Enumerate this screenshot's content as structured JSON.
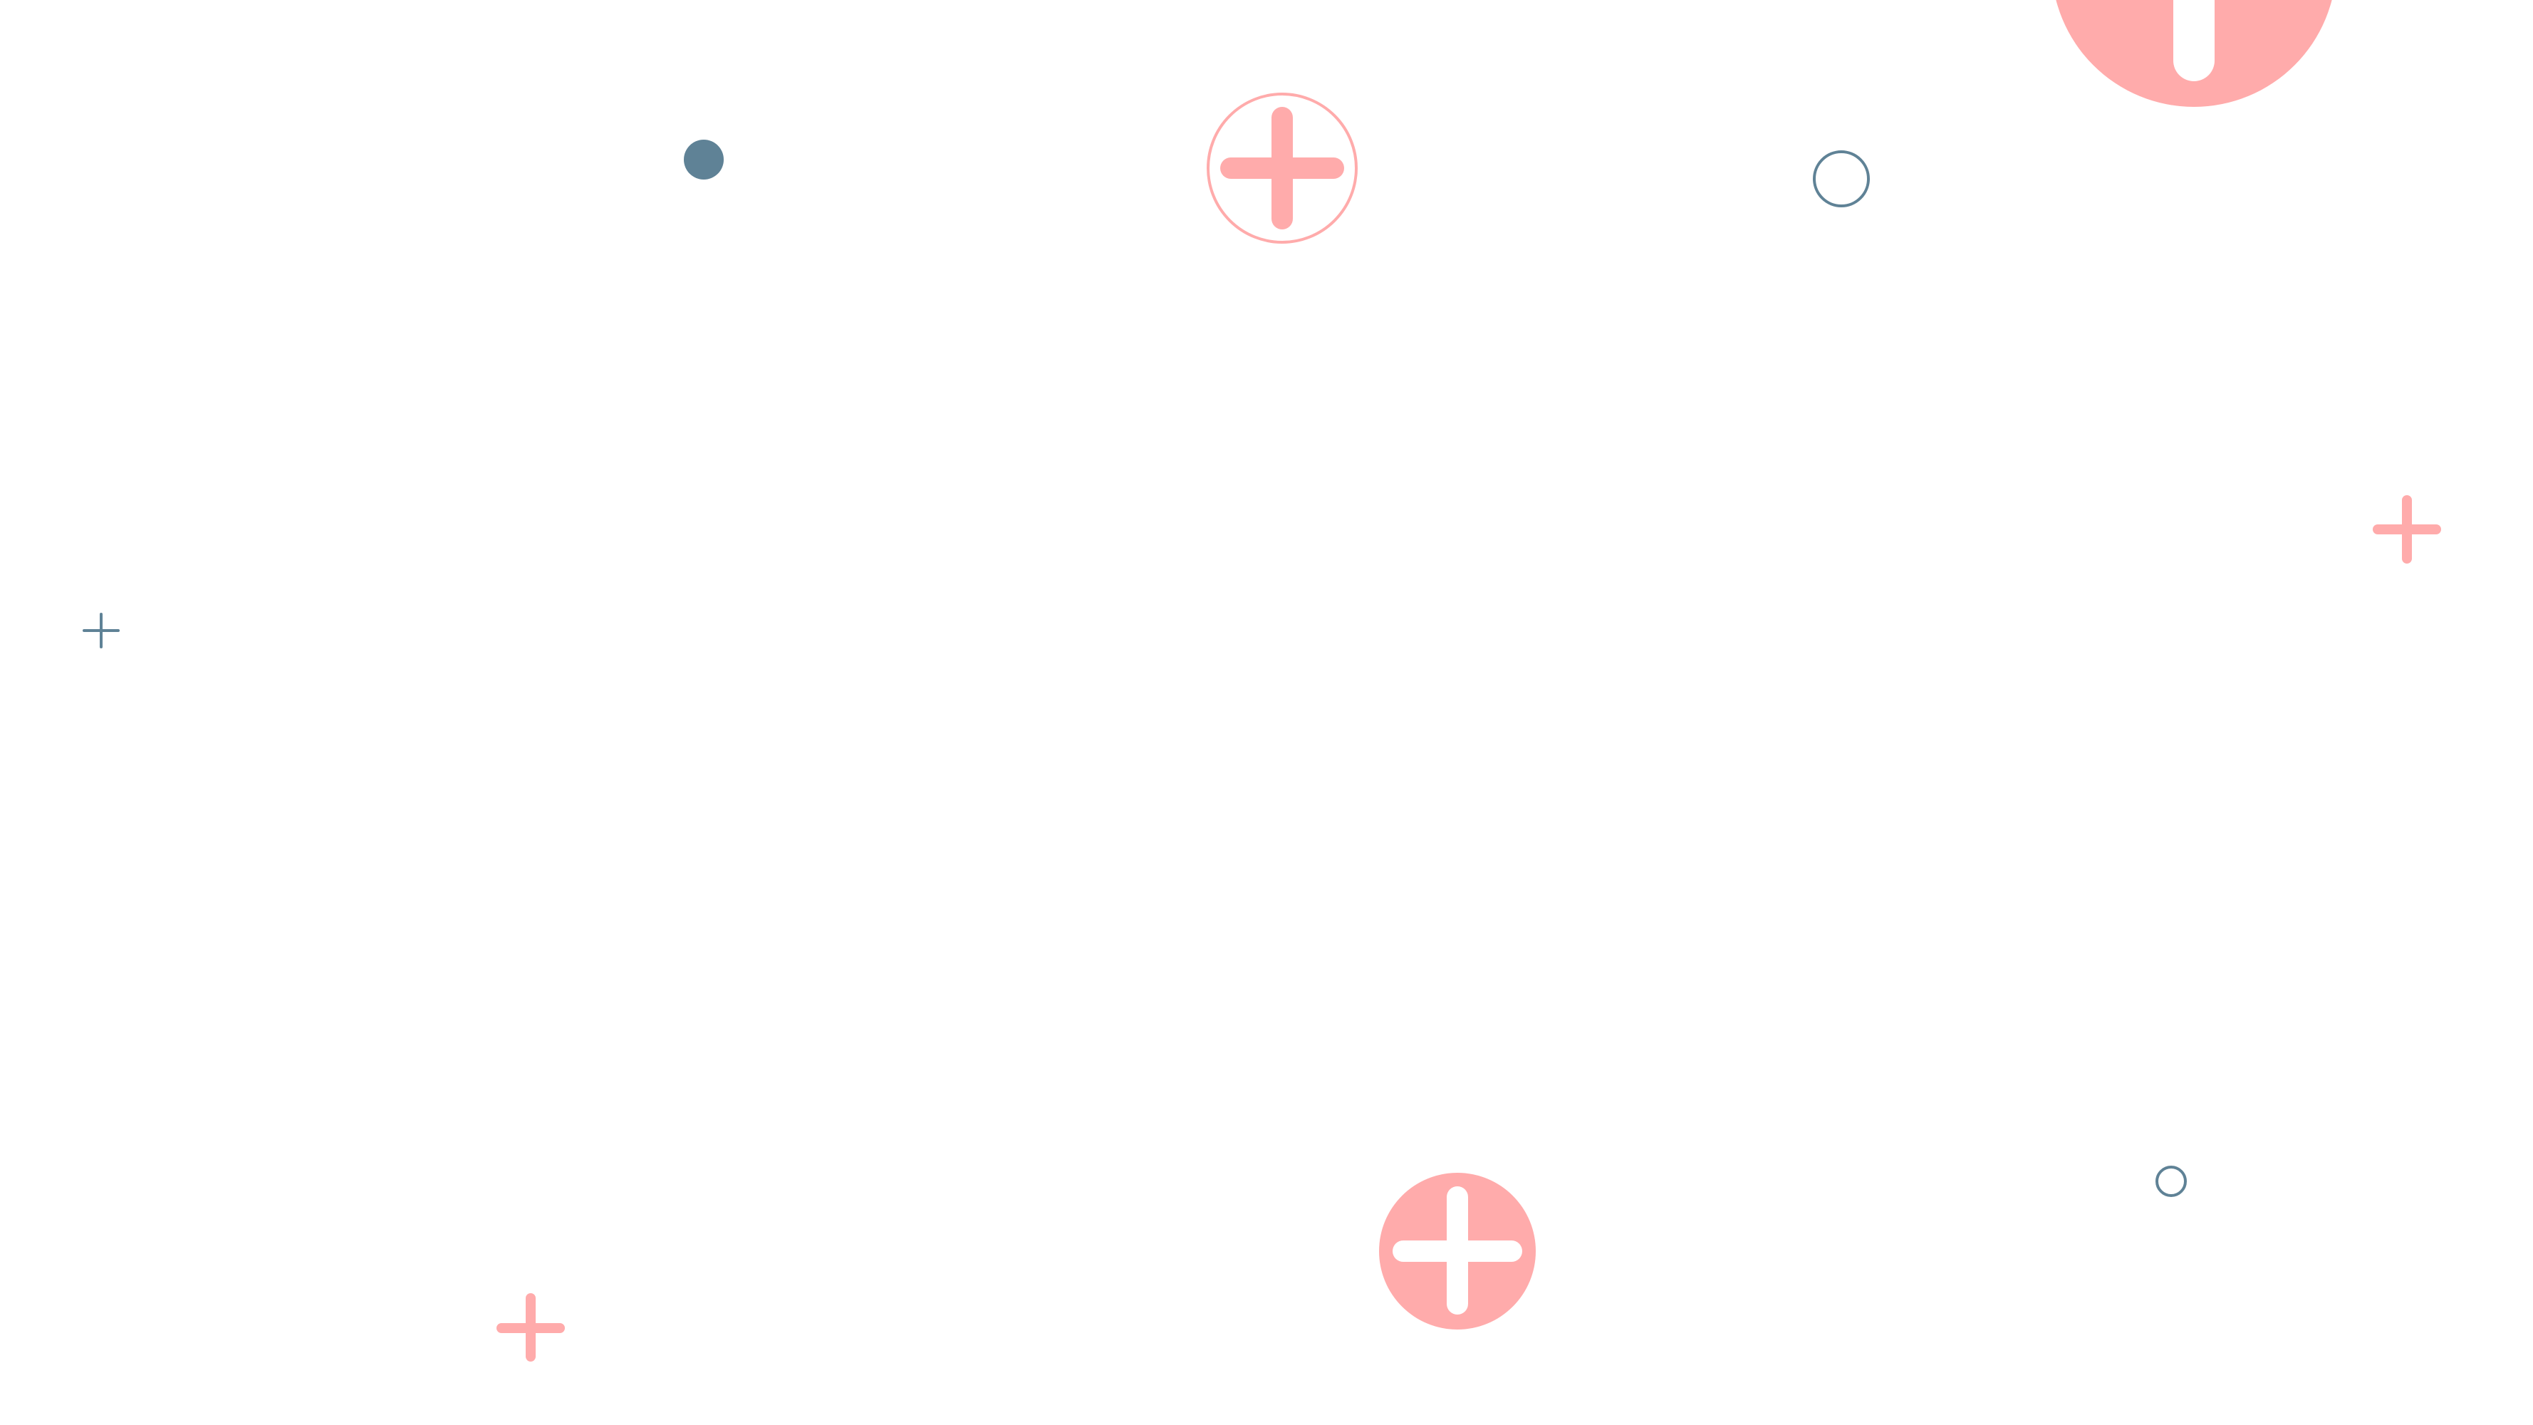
{
  "colors": {
    "background": "#ffffff",
    "pink": "#ffabab",
    "slate": "#5f8296",
    "white": "#ffffff"
  },
  "icons": [
    "large-plus-circle-icon",
    "outlined-plus-circle-icon",
    "filled-plus-circle-icon",
    "slate-dot-icon",
    "slate-ring-icon",
    "small-slate-ring-icon",
    "pink-plus-icon",
    "thin-slate-plus-icon"
  ]
}
